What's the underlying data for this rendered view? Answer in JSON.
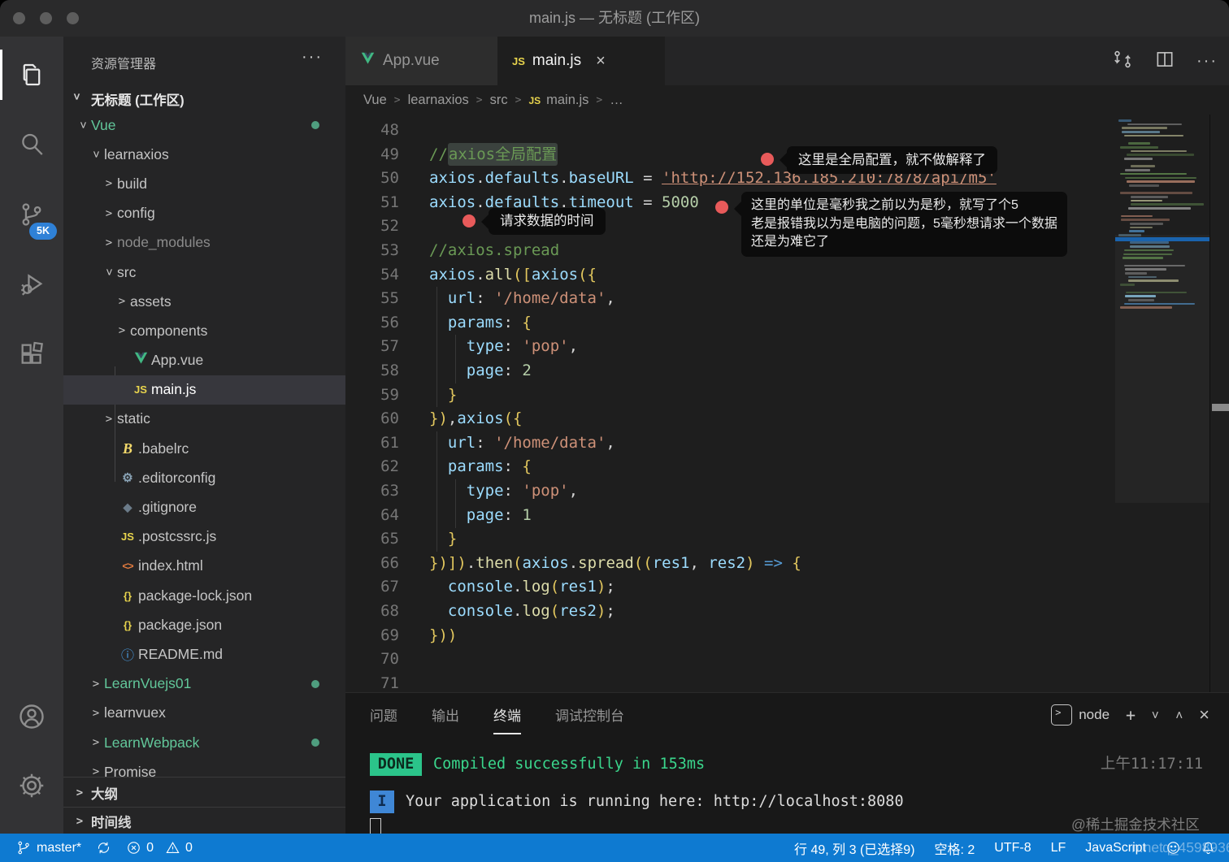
{
  "window": {
    "title": "main.js — 无标题 (工作区)"
  },
  "activity_bar": {
    "scm_badge": "5K"
  },
  "sidebar": {
    "header": "资源管理器",
    "more": "···",
    "workspace": "无标题 (工作区)",
    "tree": [
      {
        "l": "Vue",
        "i": 0,
        "c": "d",
        "cls": "green",
        "dot": true
      },
      {
        "l": "learnaxios",
        "i": 1,
        "c": "d"
      },
      {
        "l": "build",
        "i": 2,
        "c": "r"
      },
      {
        "l": "config",
        "i": 2,
        "c": "r"
      },
      {
        "l": "node_modules",
        "i": 2,
        "c": "r",
        "cls": "dim"
      },
      {
        "l": "src",
        "i": 2,
        "c": "d"
      },
      {
        "l": "assets",
        "i": 3,
        "c": "r"
      },
      {
        "l": "components",
        "i": 3,
        "c": "r"
      },
      {
        "l": "App.vue",
        "i": 3,
        "k": "vue"
      },
      {
        "l": "main.js",
        "i": 3,
        "k": "js",
        "sel": true
      },
      {
        "l": "static",
        "i": 2,
        "c": "r"
      },
      {
        "l": ".babelrc",
        "i": 2,
        "k": "babel"
      },
      {
        "l": ".editorconfig",
        "i": 2,
        "k": "gear"
      },
      {
        "l": ".gitignore",
        "i": 2,
        "k": "git"
      },
      {
        "l": ".postcssrc.js",
        "i": 2,
        "k": "js"
      },
      {
        "l": "index.html",
        "i": 2,
        "k": "html"
      },
      {
        "l": "package-lock.json",
        "i": 2,
        "k": "brace"
      },
      {
        "l": "package.json",
        "i": 2,
        "k": "brace"
      },
      {
        "l": "README.md",
        "i": 2,
        "k": "info"
      },
      {
        "l": "LearnVuejs01",
        "i": 1,
        "c": "r",
        "cls": "green",
        "dot": true
      },
      {
        "l": "learnvuex",
        "i": 1,
        "c": "r"
      },
      {
        "l": "LearnWebpack",
        "i": 1,
        "c": "r",
        "cls": "green",
        "dot": true
      },
      {
        "l": "Promise",
        "i": 1,
        "c": "r"
      }
    ],
    "sections": [
      {
        "label": "大纲"
      },
      {
        "label": "时间线"
      }
    ]
  },
  "editor": {
    "tabs": [
      {
        "label": "App.vue"
      },
      {
        "label": "main.js"
      }
    ],
    "tab_close": "×",
    "breadcrumb": [
      "Vue",
      "learnaxios",
      "src",
      "main.js",
      "…"
    ],
    "code": [
      {
        "n": 48,
        "s": []
      },
      {
        "n": 49,
        "s": [
          [
            "//",
            "cmt"
          ],
          [
            "axios全局配置",
            "cmt sel"
          ]
        ]
      },
      {
        "n": 50,
        "s": [
          [
            "axios",
            "id"
          ],
          [
            ".",
            "op"
          ],
          [
            "defaults",
            "id"
          ],
          [
            ".",
            "op"
          ],
          [
            "baseURL",
            "id"
          ],
          [
            " = ",
            "op"
          ],
          [
            "'http://152.136.185.210:7878/api/m5'",
            "str link"
          ]
        ]
      },
      {
        "n": 51,
        "s": [
          [
            "axios",
            "id"
          ],
          [
            ".",
            "op"
          ],
          [
            "defaults",
            "id"
          ],
          [
            ".",
            "op"
          ],
          [
            "timeout",
            "id"
          ],
          [
            " = ",
            "op"
          ],
          [
            "5000",
            "num"
          ]
        ]
      },
      {
        "n": 52,
        "s": []
      },
      {
        "n": 53,
        "s": [
          [
            "//axios.spread",
            "cmt"
          ]
        ]
      },
      {
        "n": 54,
        "s": [
          [
            "axios",
            "id"
          ],
          [
            ".",
            "op"
          ],
          [
            "all",
            "fn"
          ],
          [
            "(",
            "br"
          ],
          [
            "[",
            "br"
          ],
          [
            "axios",
            "id"
          ],
          [
            "(",
            "br"
          ],
          [
            "{",
            "br"
          ]
        ]
      },
      {
        "n": 55,
        "s": [
          [
            "  ",
            "op"
          ],
          [
            "url",
            "id"
          ],
          [
            ": ",
            "op"
          ],
          [
            "'/home/data'",
            "str"
          ],
          [
            ",",
            "op"
          ]
        ]
      },
      {
        "n": 56,
        "s": [
          [
            "  ",
            "op"
          ],
          [
            "params",
            "id"
          ],
          [
            ": ",
            "op"
          ],
          [
            "{",
            "br"
          ]
        ]
      },
      {
        "n": 57,
        "s": [
          [
            "    ",
            "op"
          ],
          [
            "type",
            "id"
          ],
          [
            ": ",
            "op"
          ],
          [
            "'pop'",
            "str"
          ],
          [
            ",",
            "op"
          ]
        ]
      },
      {
        "n": 58,
        "s": [
          [
            "    ",
            "op"
          ],
          [
            "page",
            "id"
          ],
          [
            ": ",
            "op"
          ],
          [
            "2",
            "num"
          ]
        ]
      },
      {
        "n": 59,
        "s": [
          [
            "  ",
            "op"
          ],
          [
            "}",
            "br"
          ]
        ]
      },
      {
        "n": 60,
        "s": [
          [
            "}",
            "br"
          ],
          [
            ")",
            "br"
          ],
          [
            ",",
            "op"
          ],
          [
            "axios",
            "id"
          ],
          [
            "(",
            "br"
          ],
          [
            "{",
            "br"
          ]
        ]
      },
      {
        "n": 61,
        "s": [
          [
            "  ",
            "op"
          ],
          [
            "url",
            "id"
          ],
          [
            ": ",
            "op"
          ],
          [
            "'/home/data'",
            "str"
          ],
          [
            ",",
            "op"
          ]
        ]
      },
      {
        "n": 62,
        "s": [
          [
            "  ",
            "op"
          ],
          [
            "params",
            "id"
          ],
          [
            ": ",
            "op"
          ],
          [
            "{",
            "br"
          ]
        ]
      },
      {
        "n": 63,
        "s": [
          [
            "    ",
            "op"
          ],
          [
            "type",
            "id"
          ],
          [
            ": ",
            "op"
          ],
          [
            "'pop'",
            "str"
          ],
          [
            ",",
            "op"
          ]
        ]
      },
      {
        "n": 64,
        "s": [
          [
            "    ",
            "op"
          ],
          [
            "page",
            "id"
          ],
          [
            ": ",
            "op"
          ],
          [
            "1",
            "num"
          ]
        ]
      },
      {
        "n": 65,
        "s": [
          [
            "  ",
            "op"
          ],
          [
            "}",
            "br"
          ]
        ]
      },
      {
        "n": 66,
        "s": [
          [
            "}",
            "br"
          ],
          [
            ")",
            "br"
          ],
          [
            "]",
            "br"
          ],
          [
            ")",
            "br"
          ],
          [
            ".",
            "op"
          ],
          [
            "then",
            "fn"
          ],
          [
            "(",
            "br"
          ],
          [
            "axios",
            "id"
          ],
          [
            ".",
            "op"
          ],
          [
            "spread",
            "fn"
          ],
          [
            "(",
            "br"
          ],
          [
            "(",
            "br"
          ],
          [
            "res1",
            "id"
          ],
          [
            ", ",
            "op"
          ],
          [
            "res2",
            "id"
          ],
          [
            ")",
            "br"
          ],
          [
            " ",
            "op"
          ],
          [
            "=>",
            "kw"
          ],
          [
            " ",
            "op"
          ],
          [
            "{",
            "br"
          ]
        ]
      },
      {
        "n": 67,
        "s": [
          [
            "  ",
            "op"
          ],
          [
            "console",
            "id"
          ],
          [
            ".",
            "op"
          ],
          [
            "log",
            "fn"
          ],
          [
            "(",
            "br"
          ],
          [
            "res1",
            "id"
          ],
          [
            ")",
            "br"
          ],
          [
            ";",
            "op"
          ]
        ]
      },
      {
        "n": 68,
        "s": [
          [
            "  ",
            "op"
          ],
          [
            "console",
            "id"
          ],
          [
            ".",
            "op"
          ],
          [
            "log",
            "fn"
          ],
          [
            "(",
            "br"
          ],
          [
            "res2",
            "id"
          ],
          [
            ")",
            "br"
          ],
          [
            ";",
            "op"
          ]
        ]
      },
      {
        "n": 69,
        "s": [
          [
            "}",
            "br"
          ],
          [
            ")",
            "br"
          ],
          [
            ")",
            "br"
          ]
        ]
      },
      {
        "n": 70,
        "s": []
      },
      {
        "n": 71,
        "s": []
      }
    ],
    "annotations": {
      "note1": "这里是全局配置，就不做解释了",
      "note2": "请求数据的时间",
      "note3": [
        "这里的单位是毫秒我之前以为是秒，就写了个5",
        "老是报错我以为是电脑的问题，5毫秒想请求一个数据",
        "还是为难它了"
      ]
    }
  },
  "panel": {
    "tabs": [
      "问题",
      "输出",
      "终端",
      "调试控制台"
    ],
    "active_tab": "终端",
    "shell_label": "node",
    "add_label": "+",
    "close_label": "×",
    "done_badge": "DONE",
    "done_message": "Compiled successfully in 153ms",
    "timestamp": "上午11:17:11",
    "info_badge": "I",
    "run_message": "Your application is running here: http://localhost:8080"
  },
  "status_bar": {
    "branch": "master*",
    "errors": "0",
    "warnings": "0",
    "cursor_position": "行 49, 列 3 (已选择9)",
    "indentation": "空格: 2",
    "encoding": "UTF-8",
    "eol": "LF",
    "language": "JavaScript"
  },
  "watermark": {
    "line1": "@稀土掘金技术社区",
    "line2a": "n.net",
    "line2b": "q_45989363"
  },
  "theme": {
    "accent": "#0e7ad1",
    "badge_blue": "#2f81d7",
    "annotation_red": "#e85a5a",
    "done_green": "#2bc48a"
  }
}
